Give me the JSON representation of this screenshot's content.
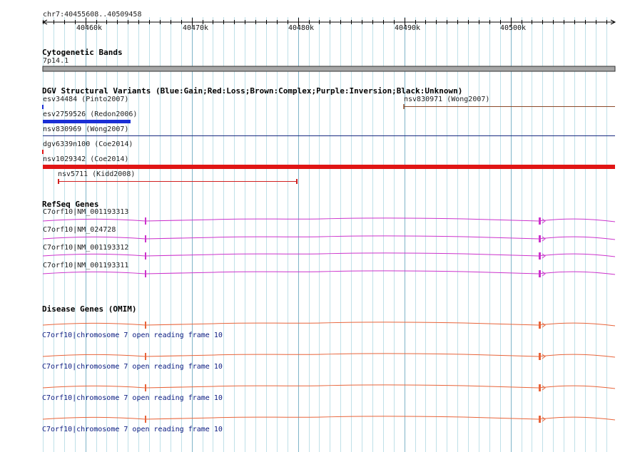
{
  "region_label": "chr7:40455608..40509458",
  "ruler_ticks": [
    "40460k",
    "40470k",
    "40480k",
    "40490k",
    "40500k"
  ],
  "tracks": {
    "cytoband": {
      "title": "Cytogenetic Bands",
      "band_label": "7p14.1"
    },
    "dgv": {
      "title": "DGV Structural Variants (Blue:Gain;Red:Loss;Brown:Complex;Purple:Inversion;Black:Unknown)",
      "features": [
        {
          "label": "esv34484 (Pinto2007)",
          "color": "#1a2fd6"
        },
        {
          "label": "nsv830971 (Wong2007)",
          "color": "#8b4a2a"
        },
        {
          "label": "esv2759526 (Redon2006)",
          "color": "#1a2fd6"
        },
        {
          "label": "nsv830969 (Wong2007)",
          "color": "#1a2a80"
        },
        {
          "label": "dgv6339n100 (Coe2014)",
          "color": "#e01515"
        },
        {
          "label": "nsv1029342 (Coe2014)",
          "color": "#e01515"
        },
        {
          "label": "nsv5711 (Kidd2008)",
          "color": "#d02020"
        }
      ]
    },
    "refseq": {
      "title": "RefSeq Genes",
      "color": "#cc33cc",
      "genes": [
        {
          "label": "C7orf10|NM_001193313"
        },
        {
          "label": "C7orf10|NM_024728"
        },
        {
          "label": "C7orf10|NM_001193312"
        },
        {
          "label": "C7orf10|NM_001193311"
        }
      ]
    },
    "omim": {
      "title": "Disease Genes (OMIM)",
      "color": "#e8643a",
      "genes": [
        {
          "label": "C7orf10|chromosome 7 open reading frame 10"
        },
        {
          "label": "C7orf10|chromosome 7 open reading frame 10"
        },
        {
          "label": "C7orf10|chromosome 7 open reading frame 10"
        },
        {
          "label": "C7orf10|chromosome 7 open reading frame 10"
        }
      ]
    }
  }
}
